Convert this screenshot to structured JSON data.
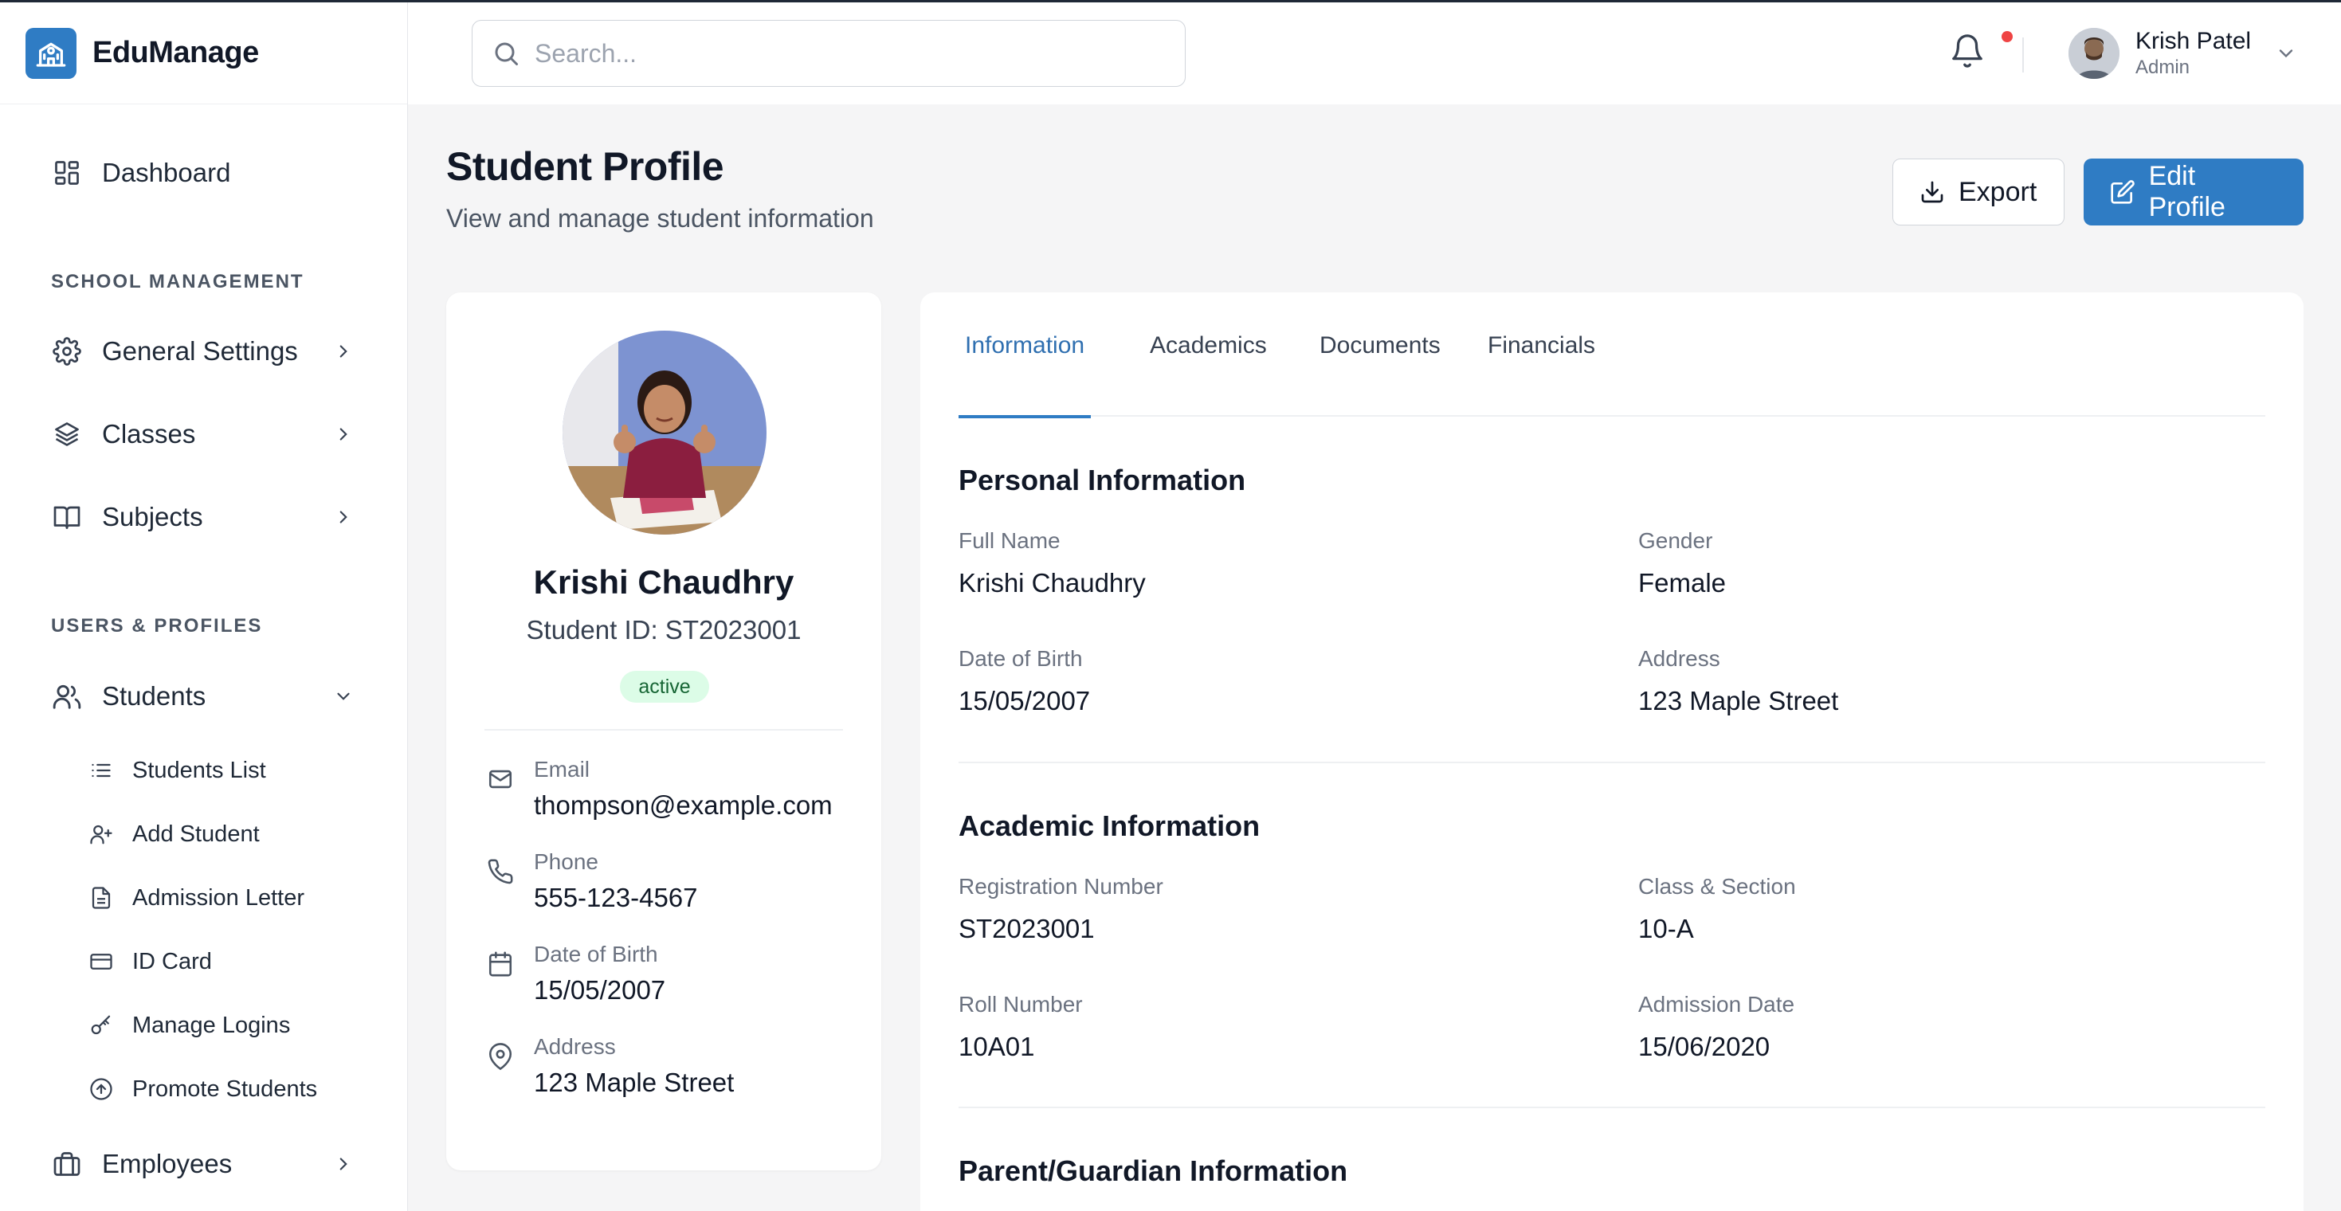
{
  "app": {
    "name": "EduManage",
    "logo_icon": "school-building-icon",
    "brand_color": "#2f7cc4"
  },
  "search": {
    "placeholder": "Search..."
  },
  "header": {
    "user": {
      "name": "Krish Patel",
      "role": "Admin"
    },
    "notification_dot_color": "#ef4444"
  },
  "sidebar": {
    "dashboard": "Dashboard",
    "sections": {
      "school_management": "SCHOOL MANAGEMENT",
      "users_profiles": "USERS & PROFILES"
    },
    "school_items": [
      {
        "label": "General Settings",
        "icon": "gear-icon"
      },
      {
        "label": "Classes",
        "icon": "layers-icon"
      },
      {
        "label": "Subjects",
        "icon": "book-icon"
      }
    ],
    "students": {
      "label": "Students",
      "icon": "users-icon",
      "expanded": true
    },
    "student_subitems": [
      {
        "label": "Students List",
        "icon": "list-icon"
      },
      {
        "label": "Add Student",
        "icon": "user-plus-icon"
      },
      {
        "label": "Admission Letter",
        "icon": "document-icon"
      },
      {
        "label": "ID Card",
        "icon": "card-icon"
      },
      {
        "label": "Manage Logins",
        "icon": "key-icon"
      },
      {
        "label": "Promote Students",
        "icon": "arrow-up-circle-icon"
      }
    ],
    "employees": {
      "label": "Employees",
      "icon": "briefcase-icon"
    }
  },
  "page": {
    "title": "Student Profile",
    "subtitle": "View and manage student information",
    "export_label": "Export",
    "edit_label": "Edit Profile"
  },
  "profile": {
    "name": "Krishi Chaudhry",
    "student_id": "Student ID: ST2023001",
    "status": "active",
    "contacts": {
      "email": {
        "label": "Email",
        "value": "thompson@example.com"
      },
      "phone": {
        "label": "Phone",
        "value": "555-123-4567"
      },
      "dob": {
        "label": "Date of Birth",
        "value": "15/05/2007"
      },
      "address": {
        "label": "Address",
        "value": "123 Maple Street"
      }
    }
  },
  "tabs": [
    "Information",
    "Academics",
    "Documents",
    "Financials"
  ],
  "active_tab": "Information",
  "personal": {
    "title": "Personal Information",
    "full_name": {
      "label": "Full Name",
      "value": "Krishi Chaudhry"
    },
    "gender": {
      "label": "Gender",
      "value": "Female"
    },
    "dob": {
      "label": "Date of Birth",
      "value": "15/05/2007"
    },
    "address": {
      "label": "Address",
      "value": "123 Maple Street"
    }
  },
  "academic": {
    "title": "Academic Information",
    "registration_number": {
      "label": "Registration Number",
      "value": "ST2023001"
    },
    "class_section": {
      "label": "Class & Section",
      "value": "10-A"
    },
    "roll_number": {
      "label": "Roll Number",
      "value": "10A01"
    },
    "admission_date": {
      "label": "Admission Date",
      "value": "15/06/2020"
    }
  },
  "parent": {
    "title": "Parent/Guardian Information"
  }
}
